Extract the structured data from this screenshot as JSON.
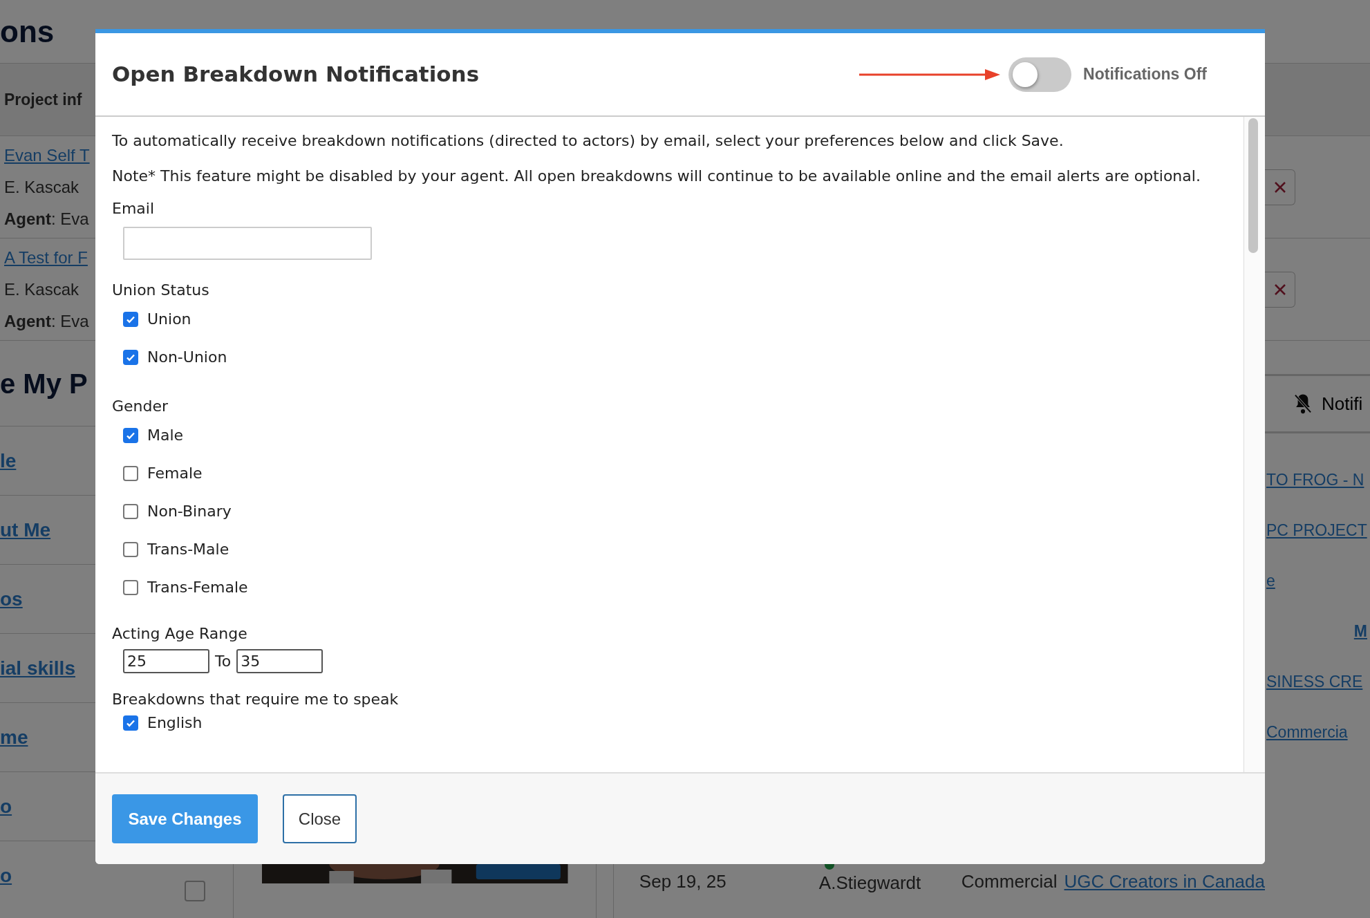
{
  "background": {
    "left": {
      "heading": "ons",
      "tab": "Project inf",
      "projects": [
        {
          "title": "Evan Self T",
          "person": "E. Kascak",
          "agent": "**Agent**: Eva"
        },
        {
          "title": "A Test for F",
          "person": "E. Kascak",
          "agent": "**Agent**: Eva"
        }
      ],
      "section_heading": "e My P",
      "links": [
        "le",
        "ut Me",
        "os",
        "ial skills",
        "me",
        "o",
        "o"
      ]
    },
    "right": {
      "notifications": "Notifi",
      "links": [
        {
          "text": "TO FROG - N",
          "kind": "link"
        },
        {
          "text": "PC PROJECT",
          "kind": "link"
        },
        {
          "text": "e",
          "kind": "link"
        },
        {
          "text": "M",
          "kind": "bold"
        },
        {
          "text": "SINESS CRE",
          "kind": "link"
        },
        {
          "text": "Commercia",
          "kind": "link"
        }
      ]
    },
    "bottom_row": {
      "checked": false,
      "date": "Sep 19, 25",
      "person": "A.Stiegwardt",
      "category": "Commercial",
      "project": "UGC Creators in Canada"
    }
  },
  "modal": {
    "title": "Open Breakdown Notifications",
    "toggle": {
      "on": false,
      "label": "Notifications Off"
    },
    "intro": "To automatically receive breakdown notifications (directed to actors) by email, select your preferences below and click Save.",
    "note": "Note* This feature might be disabled by your agent. All open breakdowns will continue to be available online and the email alerts are optional.",
    "email": {
      "label": "Email"
    },
    "groups": [
      {
        "label": "Union Status",
        "options": [
          {
            "label": "Union",
            "checked": true
          },
          {
            "label": "Non-Union",
            "checked": true
          }
        ]
      },
      {
        "label": "Gender",
        "options": [
          {
            "label": "Male",
            "checked": true
          },
          {
            "label": "Female",
            "checked": false
          },
          {
            "label": "Non-Binary",
            "checked": false
          },
          {
            "label": "Trans-Male",
            "checked": false
          },
          {
            "label": "Trans-Female",
            "checked": false
          }
        ]
      }
    ],
    "age_range": {
      "label": "Acting Age Range",
      "from": "25",
      "to_label": "To",
      "to": "35"
    },
    "speak": {
      "label": "Breakdowns that require me to speak",
      "options": [
        {
          "label": "English",
          "checked": true
        }
      ]
    },
    "buttons": {
      "save": "Save Changes",
      "close": "Close"
    }
  }
}
